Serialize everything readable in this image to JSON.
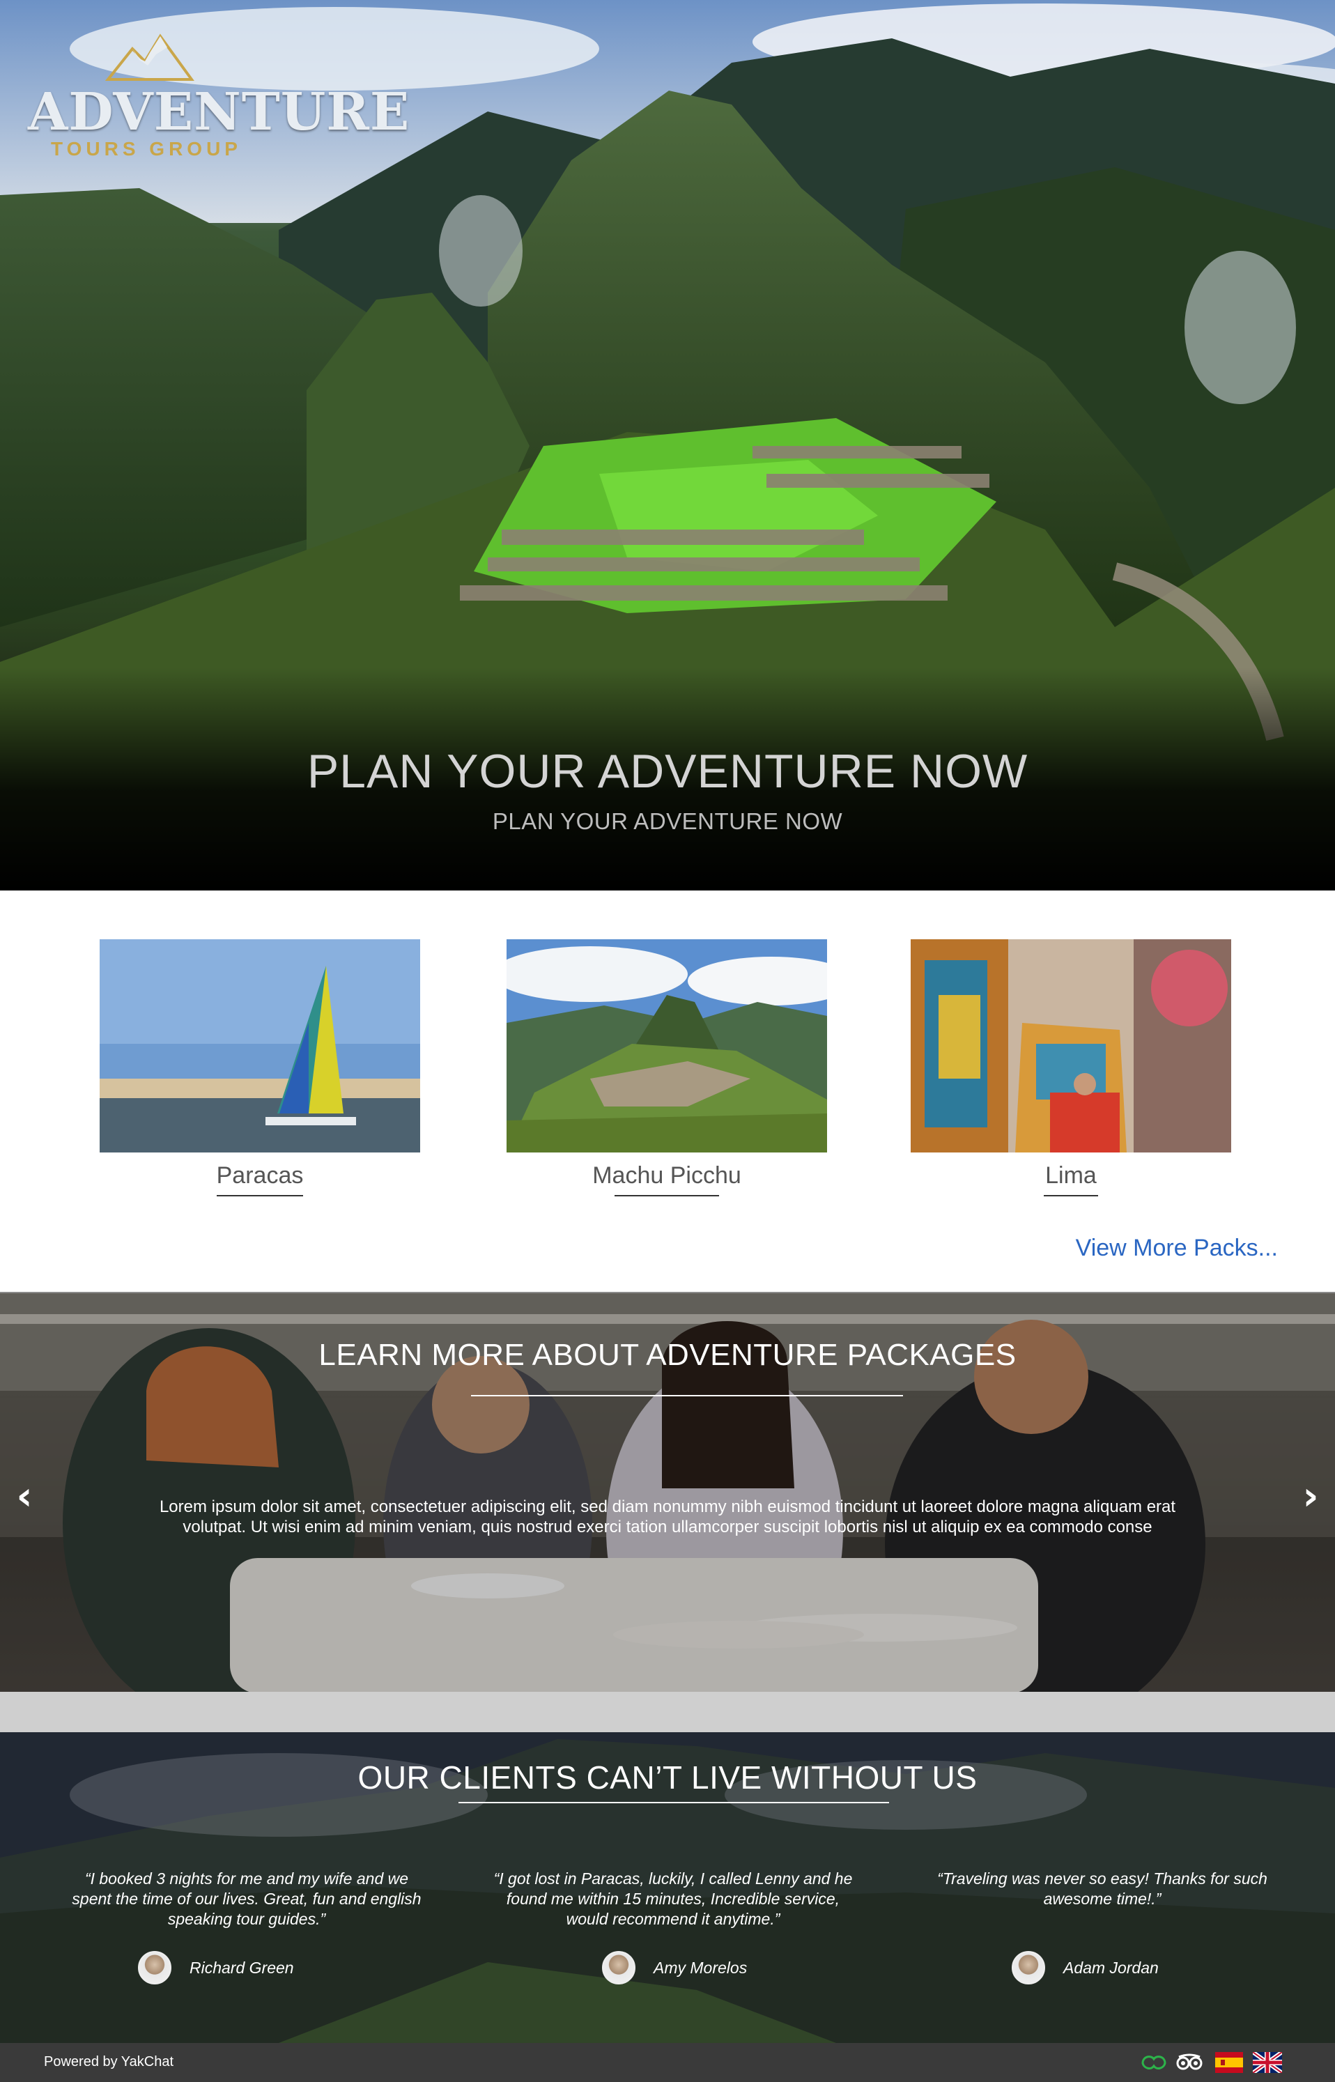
{
  "brand": {
    "name": "ADVENTURE",
    "tagline": "TOURS GROUP"
  },
  "hero": {
    "title": "PLAN YOUR ADVENTURE NOW",
    "subtitle": "PLAN YOUR ADVENTURE NOW"
  },
  "packages": {
    "items": [
      {
        "name": "Paracas",
        "image": "sailboat-photo"
      },
      {
        "name": "Machu Picchu",
        "image": "machu-picchu-photo"
      },
      {
        "name": "Lima",
        "image": "street-art-photo"
      }
    ],
    "view_more": "View More Packs..."
  },
  "learn": {
    "title": "LEARN MORE ABOUT ADVENTURE PACKAGES",
    "text": "Lorem ipsum dolor sit amet, consectetuer adipiscing elit, sed diam nonummy nibh euismod tincidunt ut laoreet dolore magna aliquam erat volutpat. Ut wisi enim ad minim veniam, quis nostrud exerci tation ullamcorper suscipit lobortis nisl ut aliquip ex ea commodo conse",
    "prev_icon": "chevron-left-icon",
    "next_icon": "chevron-right-icon"
  },
  "clients": {
    "title": "OUR CLIENTS CAN’T LIVE WITHOUT US",
    "testimonials": [
      {
        "quote": "“I booked 3 nights for me and my wife and we spent the time of our lives. Great, fun and english speaking tour guides.”",
        "name": "Richard Green"
      },
      {
        "quote": "“I got lost in Paracas, luckily, I called Lenny and he found me within 15 minutes, Incredible service, would recommend it anytime.”",
        "name": "Amy Morelos"
      },
      {
        "quote": "“Traveling was never so easy! Thanks for such awesome time!.”",
        "name": "Adam Jordan"
      }
    ]
  },
  "footer": {
    "powered_by": "Powered by YakChat",
    "icons": [
      "yakchat-icon",
      "tripadvisor-icon",
      "spanish-flag-icon",
      "english-flag-icon"
    ]
  }
}
